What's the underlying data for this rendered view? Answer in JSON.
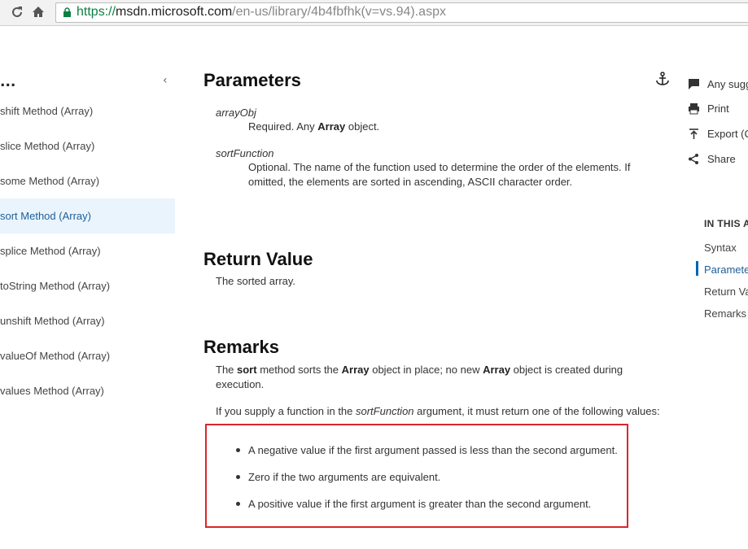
{
  "browser": {
    "url_scheme": "https://",
    "url_host": "msdn.microsoft.com",
    "url_path": "/en-us/library/4b4fbfhk(v=vs.94).aspx",
    "reload_icon": "reload-icon",
    "home_icon": "home-icon"
  },
  "left_nav": {
    "header": "...",
    "items": [
      {
        "label": "shift Method (Array)"
      },
      {
        "label": "slice Method (Array)"
      },
      {
        "label": "some Method (Array)"
      },
      {
        "label": "sort Method (Array)"
      },
      {
        "label": "splice Method (Array)"
      },
      {
        "label": "toString Method (Array)"
      },
      {
        "label": "unshift Method (Array)"
      },
      {
        "label": "valueOf Method (Array)"
      },
      {
        "label": "values Method (Array)"
      }
    ],
    "active_index": 3
  },
  "parameters": {
    "heading": "Parameters",
    "p1_name": "arrayObj",
    "p1_desc_a": "Required. Any ",
    "p1_desc_b": "Array",
    "p1_desc_c": " object.",
    "p2_name": "sortFunction",
    "p2_desc_line1": "Optional. The name of the function used to determine the order of the elements. If",
    "p2_desc_line2": "omitted, the elements are sorted in ascending, ASCII character order."
  },
  "return_value": {
    "heading": "Return Value",
    "text": "The sorted array."
  },
  "remarks": {
    "heading": "Remarks",
    "l1_a": "The ",
    "l1_b": "sort",
    "l1_c": " method sorts the ",
    "l1_d": "Array",
    "l1_e": " object in place; no new ",
    "l1_f": "Array",
    "l1_g": " object is created during",
    "l2": "execution.",
    "p2_a": "If you supply a function in the ",
    "p2_b": "sortFunction",
    "p2_c": " argument, it must return one of the following values:",
    "bullets": [
      "A negative value if the first argument passed is less than the second argument.",
      "Zero if the two arguments are equivalent.",
      "A positive value if the first argument is greater than the second argument."
    ]
  },
  "right_rail": {
    "actions": [
      {
        "label": "Any sugg",
        "icon": "comment-icon"
      },
      {
        "label": "Print",
        "icon": "print-icon"
      },
      {
        "label": "Export (C",
        "icon": "export-icon"
      },
      {
        "label": "Share",
        "icon": "share-icon"
      }
    ],
    "toc_title": "IN THIS A",
    "toc_items": [
      {
        "label": "Syntax"
      },
      {
        "label": "Paramete"
      },
      {
        "label": "Return Va"
      },
      {
        "label": "Remarks"
      }
    ],
    "toc_active_index": 1
  },
  "colors": {
    "accent": "#0065b3",
    "highlight_border": "#d9262c",
    "active_nav_bg": "#eaf4fc"
  }
}
